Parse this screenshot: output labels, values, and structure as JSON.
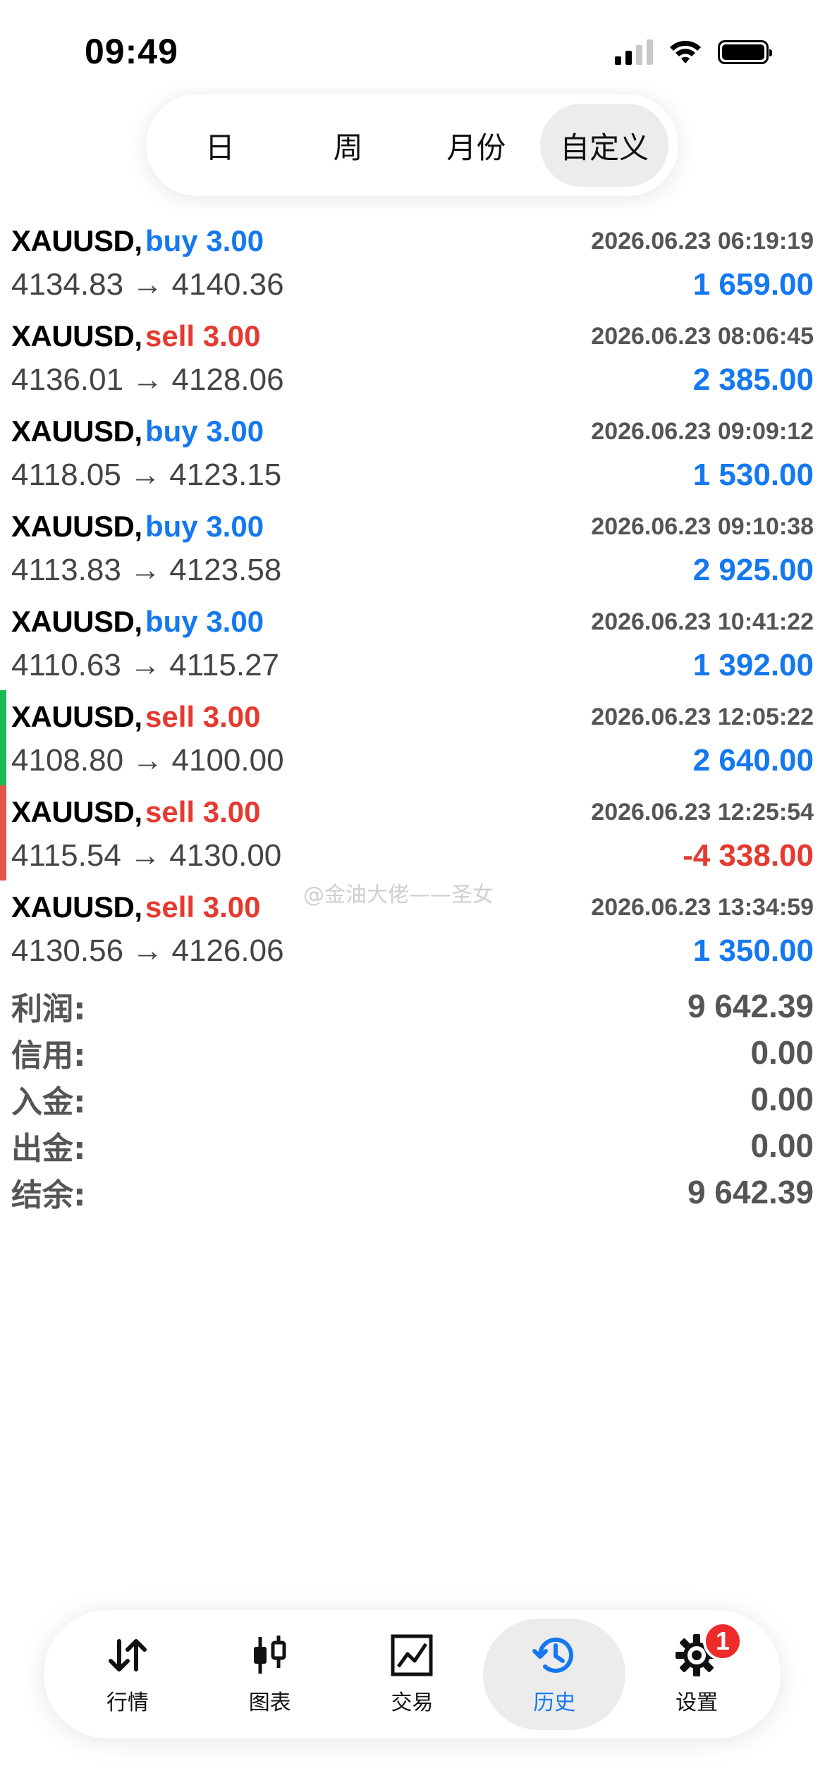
{
  "status_bar": {
    "time": "09:49"
  },
  "period_tabs": [
    {
      "label": "日",
      "active": false
    },
    {
      "label": "周",
      "active": false
    },
    {
      "label": "月份",
      "active": false
    },
    {
      "label": "自定义",
      "active": true
    }
  ],
  "deals": [
    {
      "symbol": "XAUUSD,",
      "side": "buy",
      "volume": "buy 3.00",
      "time": "2026.06.23 06:19:19",
      "prices": "4134.83 → 4140.36",
      "profit": "1 659.00",
      "marker": null
    },
    {
      "symbol": "XAUUSD,",
      "side": "sell",
      "volume": "sell 3.00",
      "time": "2026.06.23 08:06:45",
      "prices": "4136.01 → 4128.06",
      "profit": "2 385.00",
      "marker": null
    },
    {
      "symbol": "XAUUSD,",
      "side": "buy",
      "volume": "buy 3.00",
      "time": "2026.06.23 09:09:12",
      "prices": "4118.05 → 4123.15",
      "profit": "1 530.00",
      "marker": null
    },
    {
      "symbol": "XAUUSD,",
      "side": "buy",
      "volume": "buy 3.00",
      "time": "2026.06.23 09:10:38",
      "prices": "4113.83 → 4123.58",
      "profit": "2 925.00",
      "marker": null
    },
    {
      "symbol": "XAUUSD,",
      "side": "buy",
      "volume": "buy 3.00",
      "time": "2026.06.23 10:41:22",
      "prices": "4110.63 → 4115.27",
      "profit": "1 392.00",
      "marker": null
    },
    {
      "symbol": "XAUUSD,",
      "side": "sell",
      "volume": "sell 3.00",
      "time": "2026.06.23 12:05:22",
      "prices": "4108.80 → 4100.00",
      "profit": "2 640.00",
      "marker": "#1db954"
    },
    {
      "symbol": "XAUUSD,",
      "side": "sell",
      "volume": "sell 3.00",
      "time": "2026.06.23 12:25:54",
      "prices": "4115.54 → 4130.00",
      "profit": "-4 338.00",
      "marker": "#e5574c"
    },
    {
      "symbol": "XAUUSD,",
      "side": "sell",
      "volume": "sell 3.00",
      "time": "2026.06.23 13:34:59",
      "prices": "4130.56 → 4126.06",
      "profit": "1 350.00",
      "marker": null
    }
  ],
  "watermark": "@金油大佬——圣女",
  "summary": [
    {
      "label": "利润:",
      "value": "9 642.39"
    },
    {
      "label": "信用:",
      "value": "0.00"
    },
    {
      "label": "入金:",
      "value": "0.00"
    },
    {
      "label": "出金:",
      "value": "0.00"
    },
    {
      "label": "结余:",
      "value": "9 642.39"
    }
  ],
  "bottom_nav": [
    {
      "label": "行情",
      "icon": "quotes-arrows-icon",
      "active": false
    },
    {
      "label": "图表",
      "icon": "candlestick-chart-icon",
      "active": false
    },
    {
      "label": "交易",
      "icon": "trade-chart-icon",
      "active": false
    },
    {
      "label": "历史",
      "icon": "history-clock-icon",
      "active": true
    },
    {
      "label": "设置",
      "icon": "gear-icon",
      "active": false,
      "badge": "1"
    }
  ],
  "colors": {
    "buy": "#1478f0",
    "sell": "#e53a30",
    "active_nav": "#1478f0",
    "badge": "#ee2b2b"
  }
}
